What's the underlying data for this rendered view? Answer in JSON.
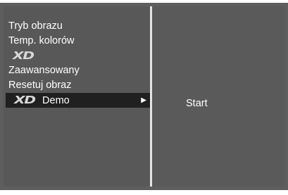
{
  "menu": {
    "items": [
      {
        "label": "Tryb obrazu"
      },
      {
        "label": "Temp. kolorów"
      },
      {
        "logo": "XD"
      },
      {
        "label": "Zaawansowany"
      },
      {
        "label": "Resetuj obraz"
      },
      {
        "logo": "XD",
        "label": "Demo",
        "selected": true
      }
    ]
  },
  "submenu": {
    "items": [
      {
        "label": "Start"
      }
    ]
  },
  "colors": {
    "frame": "#5e5e5e",
    "panel": "#585858",
    "selected": "#202020",
    "divider": "#e4e4e4",
    "text": "#ffffff"
  },
  "icons": {
    "arrow": "right-triangle-icon"
  }
}
